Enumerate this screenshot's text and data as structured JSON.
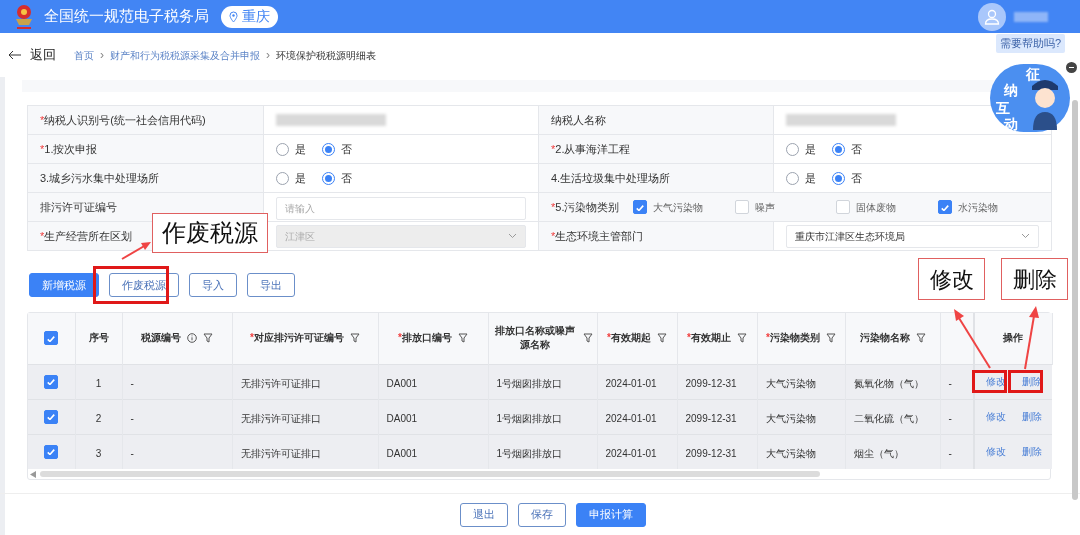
{
  "header": {
    "title": "全国统一规范电子税务局",
    "region": "重庆"
  },
  "nav": {
    "back": "返回",
    "separator": "›",
    "breadcrumb": [
      "首页",
      "财产和行为税税源采集及合并申报",
      "环境保护税税源明细表"
    ]
  },
  "help": {
    "bubble": "需要帮助吗?",
    "characters": [
      "征",
      "纳",
      "互",
      "动"
    ]
  },
  "form": {
    "rows": [
      {
        "left": {
          "label": "纳税人识别号(统一社会信用代码)",
          "marker": "*",
          "kind": "redacted"
        },
        "right": {
          "label": "纳税人名称",
          "kind": "redacted"
        }
      },
      {
        "left": {
          "label": "1.按次申报",
          "marker": "*",
          "kind": "radio",
          "options": [
            {
              "label": "是",
              "selected": false
            },
            {
              "label": "否",
              "selected": true
            }
          ]
        },
        "right": {
          "label": "2.从事海洋工程",
          "marker": "*",
          "kind": "radio",
          "options": [
            {
              "label": "是",
              "selected": false
            },
            {
              "label": "否",
              "selected": true
            }
          ]
        }
      },
      {
        "left": {
          "label": "3.城乡污水集中处理场所",
          "kind": "radio",
          "options": [
            {
              "label": "是",
              "selected": false
            },
            {
              "label": "否",
              "selected": true
            }
          ]
        },
        "right": {
          "label": "4.生活垃圾集中处理场所",
          "kind": "radio",
          "options": [
            {
              "label": "是",
              "selected": false
            },
            {
              "label": "否",
              "selected": true
            }
          ]
        }
      },
      {
        "left": {
          "label": "排污许可证编号",
          "kind": "input",
          "placeholder": "请输入"
        },
        "right": {
          "label": "5.污染物类别",
          "marker": "*",
          "kind": "checkboxes",
          "options": [
            {
              "label": "大气污染物",
              "checked": true
            },
            {
              "label": "噪声",
              "checked": false
            },
            {
              "label": "固体废物",
              "checked": false
            },
            {
              "label": "水污染物",
              "checked": true
            }
          ]
        }
      },
      {
        "left": {
          "label": "生产经营所在区划",
          "marker": "*",
          "kind": "select",
          "value": "江津区",
          "disabled": true
        },
        "right": {
          "label": "生态环境主管部门",
          "marker": "*",
          "kind": "select",
          "value": "重庆市江津区生态环境局",
          "disabled": false
        }
      }
    ]
  },
  "toolbar": [
    {
      "label": "新增税源",
      "kind": "primary"
    },
    {
      "label": "作废税源",
      "kind": "default"
    },
    {
      "label": "导入",
      "kind": "default"
    },
    {
      "label": "导出",
      "kind": "default"
    }
  ],
  "table": {
    "all_checked": true,
    "columns": [
      {
        "label": "序号",
        "filter": false,
        "info": false
      },
      {
        "label": "税源编号",
        "filter": true,
        "info": true
      },
      {
        "label": "对应排污许可证编号",
        "marker": "*",
        "filter": true,
        "info": false
      },
      {
        "label": "排放口编号",
        "marker": "*",
        "filter": true,
        "info": false
      },
      {
        "label": "排放口名称或噪声源名称",
        "filter": true,
        "info": false
      },
      {
        "label": "有效期起",
        "marker": "*",
        "filter": true,
        "info": false
      },
      {
        "label": "有效期止",
        "marker": "*",
        "filter": true,
        "info": false
      },
      {
        "label": "污染物类别",
        "marker": "*",
        "filter": true,
        "info": false
      },
      {
        "label": "污染物名称",
        "filter": true,
        "info": false
      },
      {
        "filter": false,
        "info": false
      },
      {
        "label": "操作",
        "filter": false,
        "info": false
      }
    ],
    "rows": [
      {
        "checked": true,
        "cells": [
          "1",
          "-",
          "无排污许可证排口",
          "DA001",
          "1号烟囱排放口",
          "2024-01-01",
          "2099-12-31",
          "大气污染物",
          "氮氧化物（气）",
          "-"
        ],
        "actions": [
          "修改",
          "删除"
        ]
      },
      {
        "checked": true,
        "cells": [
          "2",
          "-",
          "无排污许可证排口",
          "DA001",
          "1号烟囱排放口",
          "2024-01-01",
          "2099-12-31",
          "大气污染物",
          "二氧化硫（气）",
          "-"
        ],
        "actions": [
          "修改",
          "删除"
        ]
      },
      {
        "checked": true,
        "cells": [
          "3",
          "-",
          "无排污许可证排口",
          "DA001",
          "1号烟囱排放口",
          "2024-01-01",
          "2099-12-31",
          "大气污染物",
          "烟尘（气）",
          "-"
        ],
        "actions": [
          "修改",
          "删除"
        ]
      }
    ]
  },
  "footer": [
    {
      "label": "退出",
      "kind": "default"
    },
    {
      "label": "保存",
      "kind": "default"
    },
    {
      "label": "申报计算",
      "kind": "primary"
    }
  ],
  "annotations": [
    {
      "text": "作废税源"
    },
    {
      "text": "修改"
    },
    {
      "text": "删除"
    }
  ]
}
